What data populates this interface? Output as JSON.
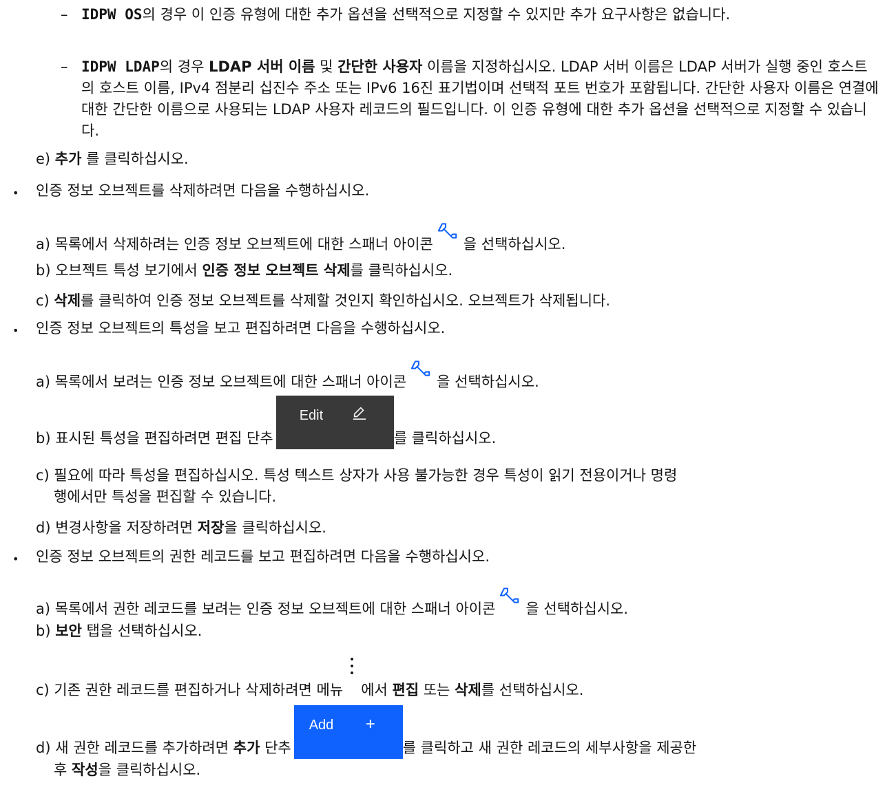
{
  "top_items": [
    {
      "dash": "–",
      "code": "IDPW OS",
      "text": "의 경우 이 인증 유형에 대한 추가 옵션을 선택적으로 지정할 수 있지만 추가 요구사항은 없습니다."
    },
    {
      "dash": "–",
      "code": "IDPW LDAP",
      "t1": "의 경우 ",
      "b1": "LDAP 서버 이름",
      "t2": " 및 ",
      "b2": "간단한 사용자",
      "t3": " 이름을 지정하십시오. LDAP 서버 이름은 LDAP 서버가 실행 중인 호스트의 호스트 이름, IPv4 점분리 십진수 주소 또는 IPv6 16진 표기법이며 선택적 포트 번호가 포함됩니다. 간단한 사용자 이름은 연결에 대한 간단한 이름으로 사용되는 LDAP 사용자 레코드의 필드입니다. 이 인증 유형에 대한 추가 옵션을 선택적으로 지정할 수 있습니다."
    }
  ],
  "step_e": {
    "prefix": "e) ",
    "bold": "추가",
    "suffix": " 를 클릭하십시오."
  },
  "bullet_glyph": "•",
  "delete_section": {
    "title": "인증 정보 오브젝트를 삭제하려면 다음을 수행하십시오.",
    "a": {
      "prefix": "a) 목록에서 삭제하려는 인증 정보 오브젝트에 대한 스패너 아이콘",
      "suffix": "을 선택하십시오."
    },
    "b": {
      "prefix": "b) 오브젝트 특성 보기에서 ",
      "bold": "인증 정보 오브젝트 삭제",
      "suffix": "를 클릭하십시오."
    },
    "c": {
      "prefix": "c) ",
      "bold": "삭제",
      "suffix": "를 클릭하여 인증 정보 오브젝트를 삭제할 것인지 확인하십시오. 오브젝트가 삭제됩니다."
    }
  },
  "edit_section": {
    "title": "인증 정보 오브젝트의 특성을 보고 편집하려면 다음을 수행하십시오.",
    "a": {
      "prefix": "a) 목록에서 보려는 인증 정보 오브젝트에 대한 스패너 아이콘",
      "suffix": "을 선택하십시오."
    },
    "b": {
      "prefix": "b) 표시된 특성을 편집하려면 편집 단추",
      "suffix": "를 클릭하십시오."
    },
    "edit_button_label": "Edit",
    "c": {
      "line1": "c) 필요에 따라 특성을 편집하십시오. 특성 텍스트 상자가 사용 불가능한 경우 특성이 읽기 전용이거나 명령",
      "line2": "행에서만 특성을 편집할 수 있습니다."
    },
    "d": {
      "prefix": "d) 변경사항을 저장하려면 ",
      "bold": "저장",
      "suffix": "을 클릭하십시오."
    }
  },
  "auth_section": {
    "title": "인증 정보 오브젝트의 권한 레코드를 보고 편집하려면 다음을 수행하십시오.",
    "a": {
      "prefix": "a) 목록에서 권한 레코드를 보려는 인증 정보 오브젝트에 대한 스패너 아이콘",
      "suffix": "을 선택하십시오."
    },
    "b": {
      "prefix": "b) ",
      "bold": "보안",
      "suffix": " 탭을 선택하십시오."
    },
    "c": {
      "prefix": "c) 기존 권한 레코드를 편집하거나 삭제하려면 메뉴",
      "mid": "에서 ",
      "bold1": "편집",
      "mid2": " 또는 ",
      "bold2": "삭제",
      "suffix": "를 선택하십시오."
    },
    "d": {
      "prefix": "d) 새 권한 레코드를 추가하려면 ",
      "bold": "추가",
      "mid": " 단추",
      "suffix": "를 클릭하고 새 권한 레코드의 세부사항을 제공한",
      "line2_prefix": "후 ",
      "line2_bold": "작성",
      "line2_suffix": "을 클릭하십시오."
    },
    "add_button_label": "Add",
    "add_button_icon": "+"
  },
  "colors": {
    "edit_button_bg": "#393939",
    "add_button_bg": "#0f62fe",
    "wrench": "#0f62fe"
  }
}
